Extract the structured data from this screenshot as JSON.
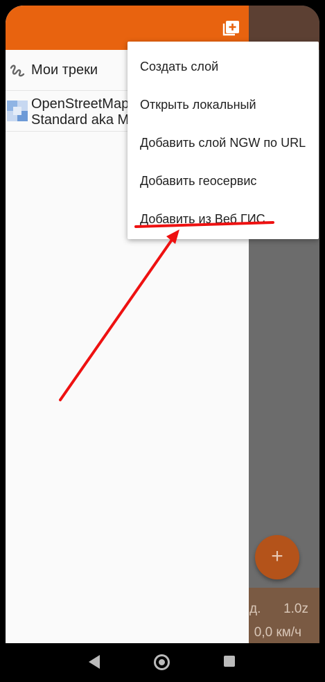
{
  "background": {
    "status_label": "д.",
    "zoom": "1.0z",
    "speed": "0,0 км/ч",
    "fab_label": "+"
  },
  "drawer": {
    "header_icon": "add-layer-icon",
    "layers": [
      {
        "icon": "track-icon",
        "name": "Мои треки"
      },
      {
        "icon": "map-tile-icon",
        "name_line1": "OpenStreetMap",
        "name_line2": "Standard aka M"
      }
    ]
  },
  "menu": {
    "items": [
      "Создать слой",
      "Открыть локальный",
      "Добавить слой NGW по URL",
      "Добавить геосервис",
      "Добавить из Веб ГИС"
    ]
  },
  "colors": {
    "accent": "#e8630f",
    "annotation": "#ee1111"
  }
}
